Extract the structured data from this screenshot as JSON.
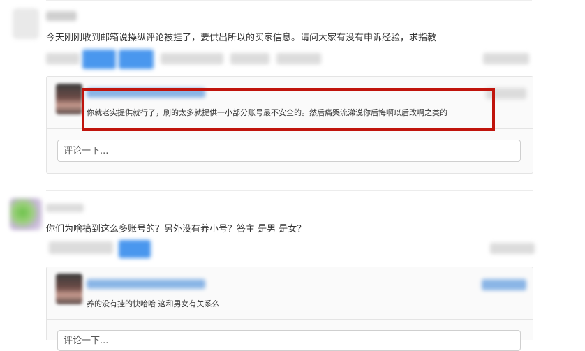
{
  "comments": [
    {
      "text": "今天刚刚收到邮箱说操纵评论被挂了，要供出所以的买家信息。请问大家有没有申诉经验，求指教",
      "reply": {
        "text": "你就老实提供就行了，刷的太多就提供一小部分账号最不安全的。然后痛哭流涕说你后悔啊以后改啊之类的"
      },
      "input_placeholder": "评论一下..."
    },
    {
      "text": "你们为啥搞到这么多账号的？另外没有养小号？答主 是男 是女？",
      "reply": {
        "text": "养的没有挂的快哈哈 这和男女有关系么"
      },
      "input_placeholder": "评论一下..."
    }
  ],
  "colors": {
    "highlight_border": "#c0140c",
    "blurred_link": "#4a97ee"
  }
}
